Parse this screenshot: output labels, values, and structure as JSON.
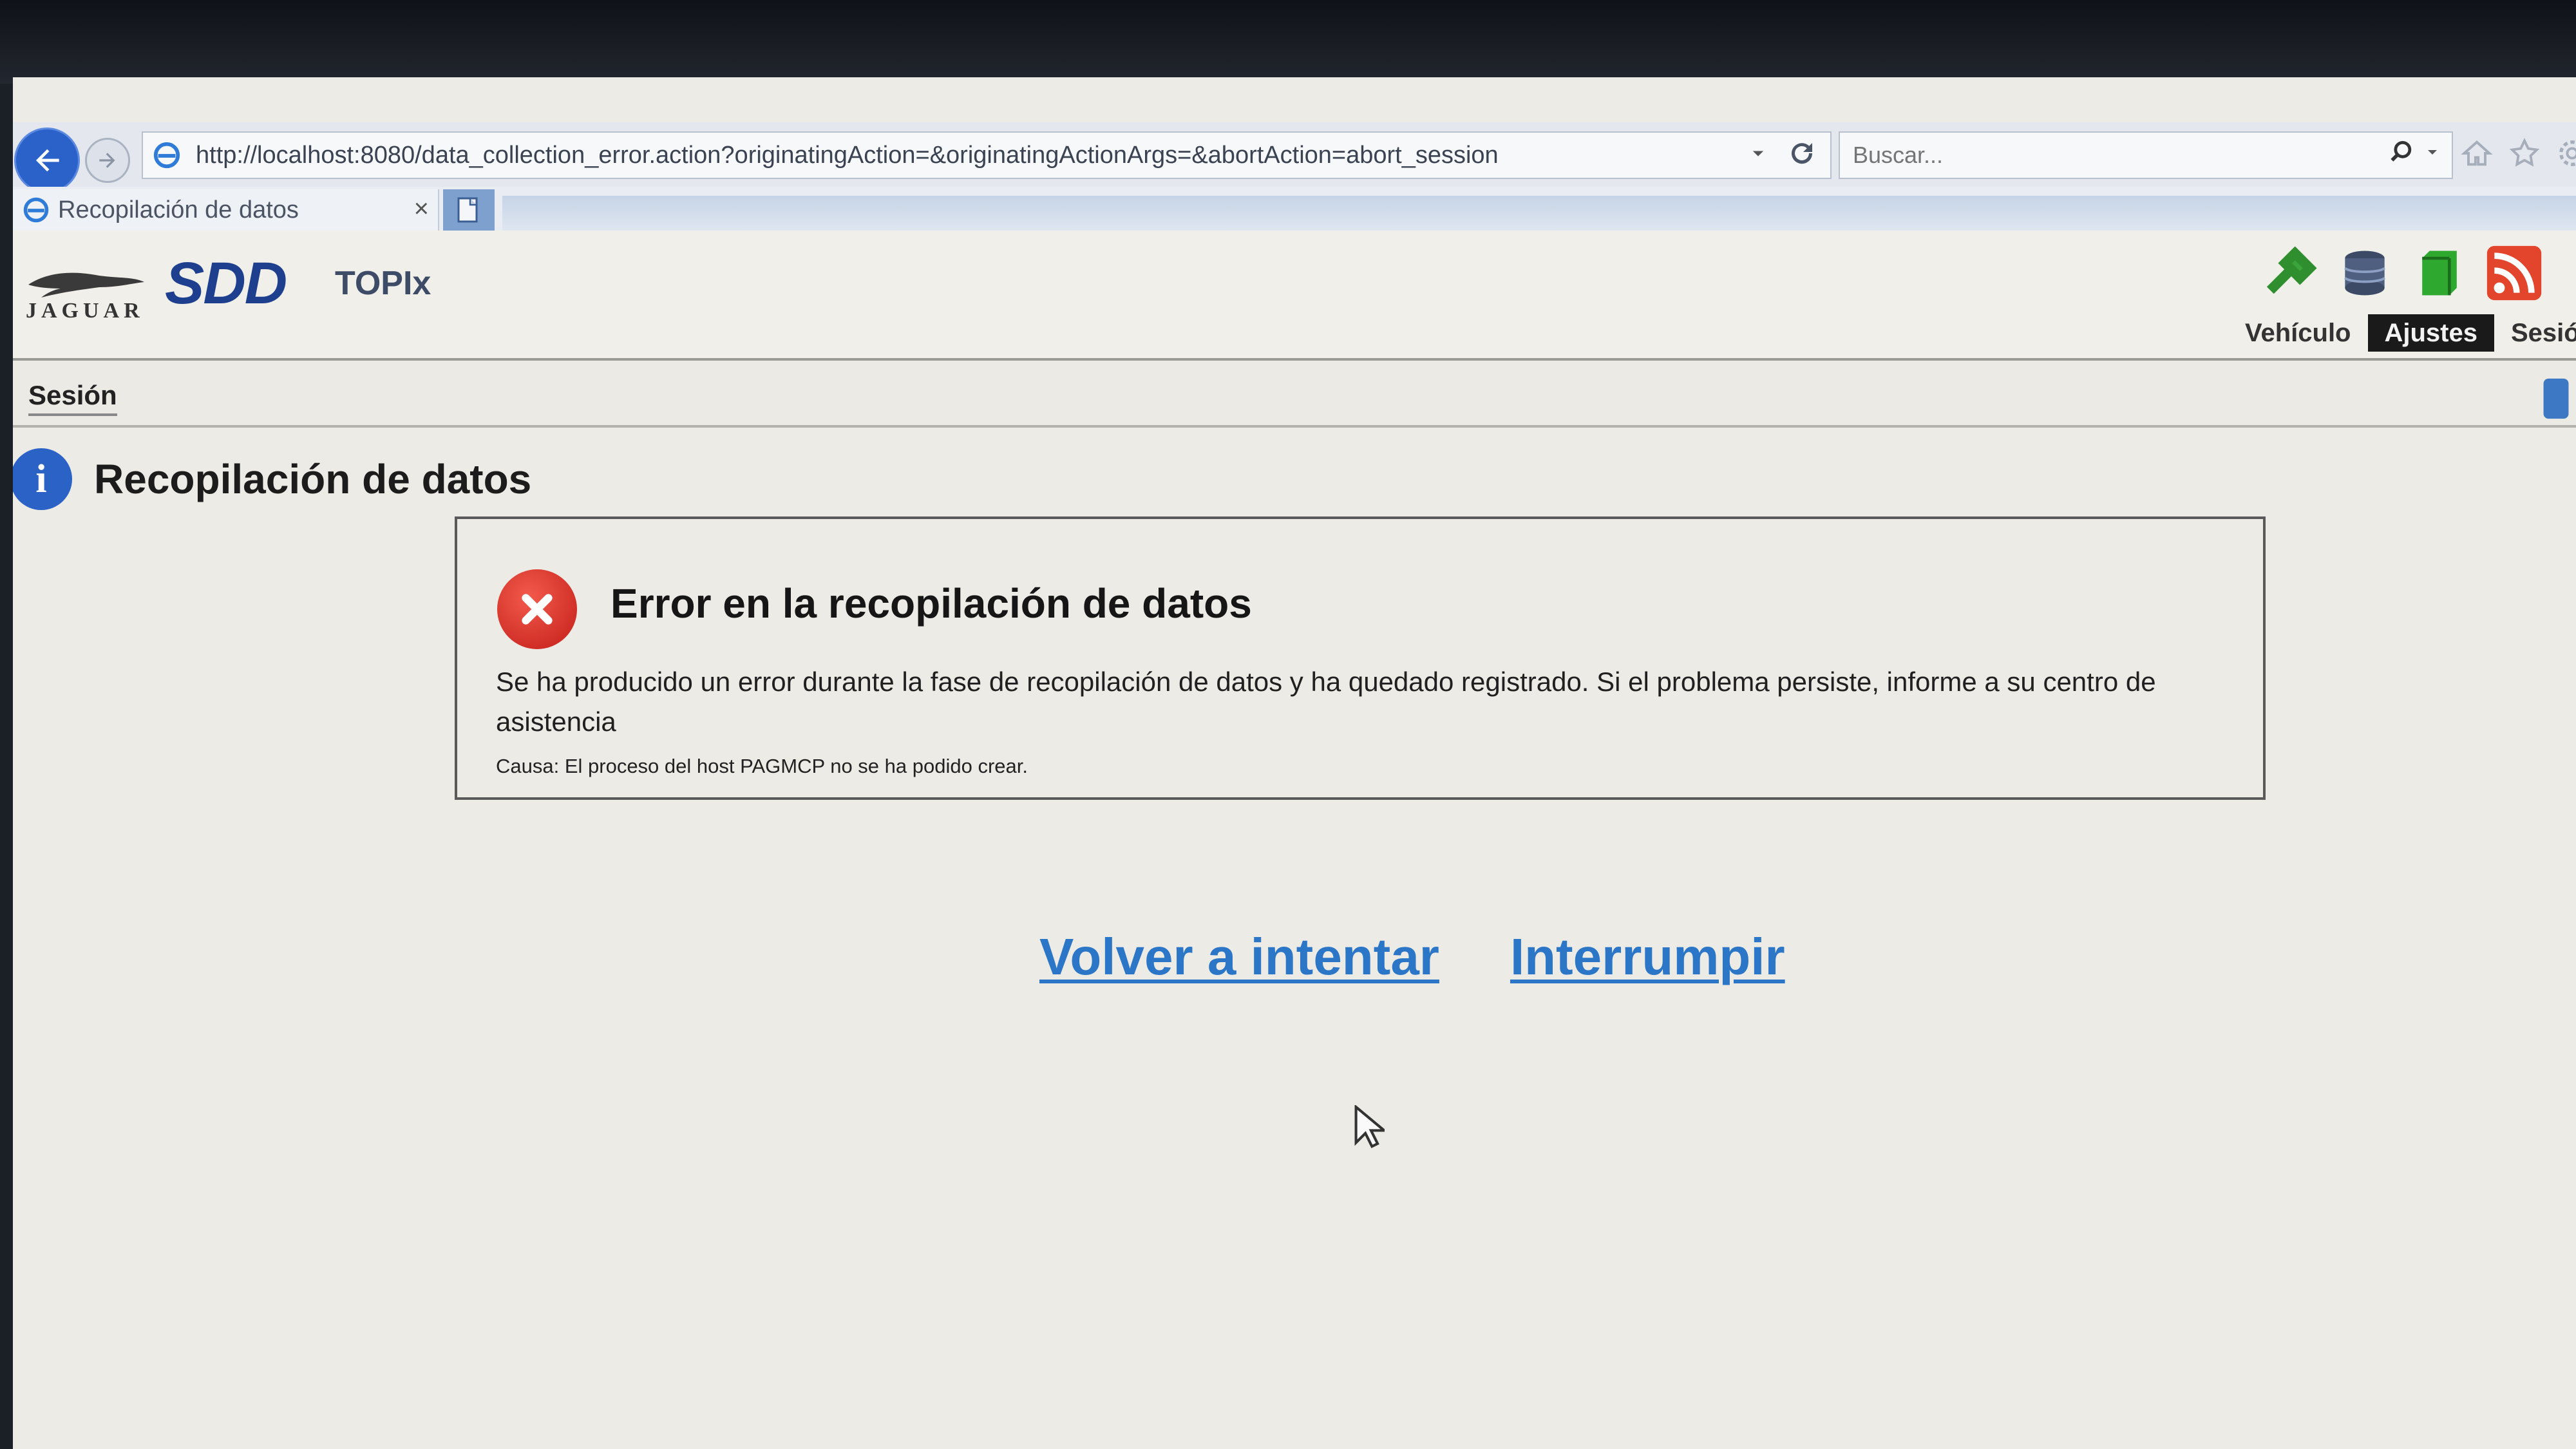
{
  "browser": {
    "url": "http://localhost:8080/data_collection_error.action?originatingAction=&originatingActionArgs=&abortAction=abort_session",
    "search_placeholder": "Buscar...",
    "tab_title": "Recopilación de datos",
    "tab_close": "×"
  },
  "header": {
    "jaguar_wordmark": "JAGUAR",
    "sdd_logo": "SDD",
    "topix_label": "TOPIx",
    "tabs": [
      {
        "label": "Vehículo",
        "active": false
      },
      {
        "label": "Ajustes",
        "active": true
      },
      {
        "label": "Sesió",
        "active": false
      }
    ]
  },
  "session_bar": {
    "label": "Sesión"
  },
  "page": {
    "title": "Recopilación de datos",
    "info_glyph": "i"
  },
  "error": {
    "title": "Error en la recopilación de datos",
    "message": "Se ha producido un error durante la fase de recopilación de datos y ha quedado registrado. Si el problema persiste, informe a su centro de asistencia",
    "cause": "Causa: El proceso del host PAGMCP no se ha podido crear."
  },
  "actions": {
    "retry_label": "Volver a intentar",
    "abort_label": "Interrumpir"
  },
  "colors": {
    "link": "#2b76c6",
    "error_red": "#c21d17",
    "info_blue": "#2a63c5",
    "sdd_blue": "#1d3f8e"
  },
  "icons": [
    "back-arrow-icon",
    "forward-arrow-icon",
    "ie-icon",
    "dropdown-icon",
    "refresh-icon",
    "search-icon",
    "home-icon",
    "star-icon",
    "gear-icon",
    "new-tab-icon",
    "wrench-icon",
    "database-icon",
    "module-icon",
    "rss-icon",
    "info-icon",
    "error-x-icon",
    "mouse-cursor-icon"
  ]
}
